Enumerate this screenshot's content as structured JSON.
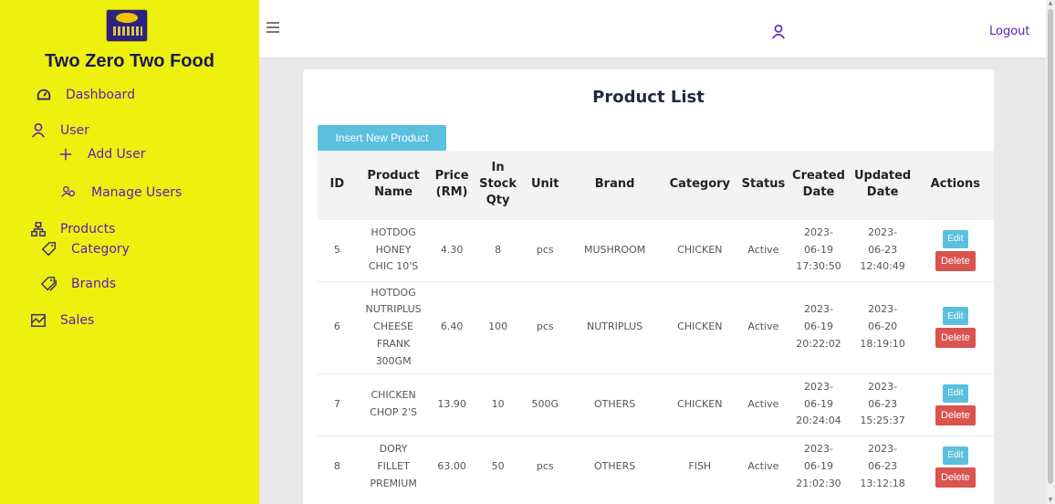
{
  "brand": {
    "title": "Two Zero Two Food",
    "logo_icon": "brand-logo"
  },
  "sidebar": {
    "items": [
      {
        "label": "Dashboard",
        "icon": "dashboard-icon"
      },
      {
        "label": "User",
        "icon": "user-icon"
      },
      {
        "label": "Add User",
        "icon": "plus-icon"
      },
      {
        "label": "Manage Users",
        "icon": "users-icon"
      },
      {
        "label": "Products",
        "icon": "sitemap-icon"
      },
      {
        "label": "Category",
        "icon": "tag-icon"
      },
      {
        "label": "Brands",
        "icon": "tags-icon"
      },
      {
        "label": "Sales",
        "icon": "chart-icon"
      }
    ],
    "bg_color": "#eef00e",
    "text_color": "#5b21b6"
  },
  "topbar": {
    "menu_icon": "hamburger-icon",
    "user_icon": "user-icon",
    "logout_label": "Logout"
  },
  "main": {
    "title": "Product List",
    "insert_button_label": "Insert New Product",
    "table": {
      "headers": {
        "id": "ID",
        "name_line1": "Product",
        "name_line2": "Name",
        "price_line1": "Price",
        "price_line2": "(RM)",
        "stock_line1": "In",
        "stock_line2": "Stock",
        "stock_line3": "Qty",
        "unit": "Unit",
        "brand": "Brand",
        "category": "Category",
        "status": "Status",
        "created_line1": "Created",
        "created_line2": "Date",
        "updated_line1": "Updated",
        "updated_line2": "Date",
        "actions": "Actions"
      },
      "rows": [
        {
          "id": "5",
          "name_lines": [
            "HOTDOG",
            "HONEY",
            "CHIC 10'S"
          ],
          "price": "4.30",
          "stock": "8",
          "unit": "pcs",
          "brand": "MUSHROOM",
          "category": "CHICKEN",
          "status": "Active",
          "created_lines": [
            "2023-",
            "06-19",
            "17:30:50"
          ],
          "updated_lines": [
            "2023-",
            "06-23",
            "12:40:49"
          ]
        },
        {
          "id": "6",
          "name_lines": [
            "HOTDOG",
            "NUTRIPLUS",
            "CHEESE",
            "FRANK",
            "300GM"
          ],
          "price": "6.40",
          "stock": "100",
          "unit": "pcs",
          "brand": "NUTRIPLUS",
          "category": "CHICKEN",
          "status": "Active",
          "created_lines": [
            "2023-",
            "06-19",
            "20:22:02"
          ],
          "updated_lines": [
            "2023-",
            "06-20",
            "18:19:10"
          ]
        },
        {
          "id": "7",
          "name_lines": [
            "CHICKEN",
            "CHOP 2'S"
          ],
          "price": "13.90",
          "stock": "10",
          "unit": "500G",
          "brand": "OTHERS",
          "category": "CHICKEN",
          "status": "Active",
          "created_lines": [
            "2023-",
            "06-19",
            "20:24:04"
          ],
          "updated_lines": [
            "2023-",
            "06-23",
            "15:25:37"
          ]
        },
        {
          "id": "8",
          "name_lines": [
            "DORY",
            "FILLET",
            "PREMIUM"
          ],
          "price": "63.00",
          "stock": "50",
          "unit": "pcs",
          "brand": "OTHERS",
          "category": "FISH",
          "status": "Active",
          "created_lines": [
            "2023-",
            "06-19",
            "21:02:30"
          ],
          "updated_lines": [
            "2023-",
            "06-23",
            "13:12:18"
          ]
        }
      ],
      "edit_label": "Edit",
      "delete_label": "Delete"
    }
  },
  "colors": {
    "info_button": "#5bc0de",
    "danger_button": "#d9534f",
    "accent_purple": "#5b21b6"
  }
}
